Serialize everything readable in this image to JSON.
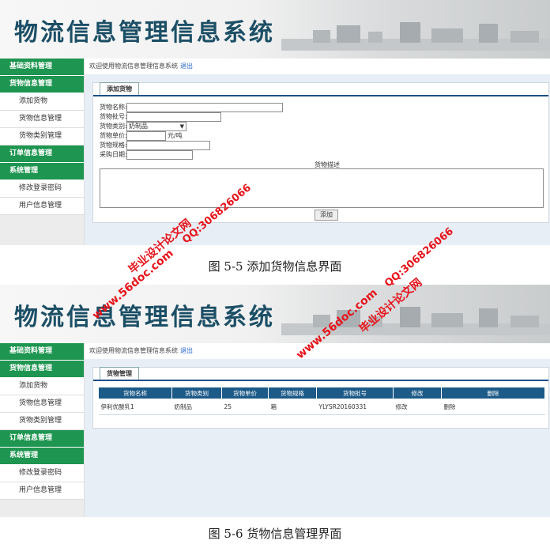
{
  "app_title": "物流信息管理信息系统",
  "sidebar": [
    {
      "type": "category",
      "label": "基础资料管理"
    },
    {
      "type": "category",
      "label": "货物信息管理"
    },
    {
      "type": "item",
      "label": "添加货物"
    },
    {
      "type": "item",
      "label": "货物信息管理"
    },
    {
      "type": "item",
      "label": "货物类别管理"
    },
    {
      "type": "category",
      "label": "订单信息管理"
    },
    {
      "type": "category",
      "label": "系统管理"
    },
    {
      "type": "item",
      "label": "修改登录密码"
    },
    {
      "type": "item",
      "label": "用户信息管理"
    }
  ],
  "welcome": {
    "text": "欢迎使用物流信息管理信息系统",
    "logout": "退出"
  },
  "add_form": {
    "tab": "添加货物",
    "fields": {
      "name": "货物名称:",
      "batch": "货物批号:",
      "category": "货物类别:",
      "category_value": "奶制品",
      "price": "货物单价:",
      "price_unit": "元/吨",
      "spec": "货物规格:",
      "date": "采购日期:"
    },
    "desc_label": "货物描述",
    "submit": "添加"
  },
  "manage": {
    "tab": "货物管理",
    "columns": [
      "货物名称",
      "货物类别",
      "货物单价",
      "货物规格",
      "货物批号",
      "修改",
      "删除"
    ],
    "row": [
      "伊利优酸乳1",
      "奶制品",
      "25",
      "箱",
      "YLYSR20160331",
      "修改",
      "删除"
    ]
  },
  "captions": {
    "fig1": "图 5-5 添加货物信息界面",
    "fig2": "图 5-6 货物信息管理界面"
  },
  "watermark": {
    "site": "www.56doc.com",
    "qq": "QQ:306826066",
    "name": "毕业设计论文网"
  },
  "colors": {
    "sidebar_green": "#1e9550",
    "header_blue": "#1c5a88",
    "title_blue": "#1c4f66",
    "watermark_red": "#e6141b"
  }
}
